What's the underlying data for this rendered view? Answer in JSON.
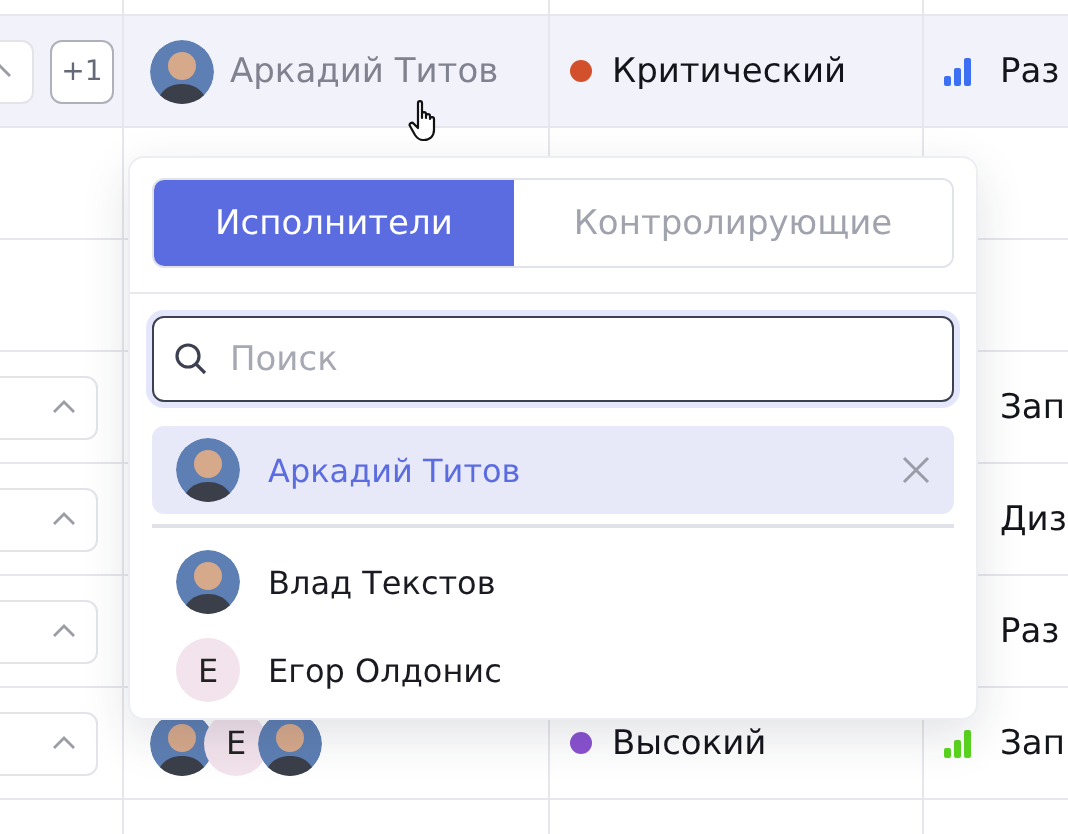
{
  "table": {
    "rows": [
      {
        "highlighted": false
      },
      {
        "highlighted": true,
        "collapse_button": true,
        "more_badge": "+1",
        "assignees": [
          {
            "kind": "photo"
          }
        ],
        "assignee_name": "Аркадий Титов",
        "priority": {
          "label": "Критический",
          "color": "#d2502c"
        },
        "type": {
          "label": "Раз",
          "color": "#3d6ff2"
        }
      },
      {
        "highlighted": false
      },
      {
        "highlighted": false
      },
      {
        "highlighted": false,
        "collapse_button": true,
        "type": {
          "label": "Зап"
        }
      },
      {
        "highlighted": false,
        "collapse_button": true,
        "type": {
          "label": "Диз"
        }
      },
      {
        "highlighted": false,
        "collapse_button": true,
        "type": {
          "label": "Раз"
        }
      },
      {
        "highlighted": false,
        "collapse_button": true,
        "assignees": [
          {
            "kind": "photo"
          },
          {
            "kind": "initial",
            "initial": "Е"
          },
          {
            "kind": "photo"
          }
        ],
        "priority": {
          "label": "Высокий",
          "color": "#8a52d0"
        },
        "type": {
          "label": "Зап",
          "color": "#5ad61e"
        }
      },
      {
        "highlighted": false
      }
    ]
  },
  "assignee_picker": {
    "tabs": [
      {
        "label": "Исполнители",
        "selected": true
      },
      {
        "label": "Контролирующие",
        "selected": false
      }
    ],
    "search": {
      "placeholder": "Поиск"
    },
    "options": [
      {
        "name": "Аркадий Титов",
        "avatar": {
          "kind": "photo"
        },
        "selected": true
      },
      {
        "name": "Влад Текстов",
        "avatar": {
          "kind": "photo"
        },
        "selected": false
      },
      {
        "name": "Егор Олдонис",
        "avatar": {
          "kind": "initial",
          "initial": "Е"
        },
        "selected": false
      }
    ]
  }
}
